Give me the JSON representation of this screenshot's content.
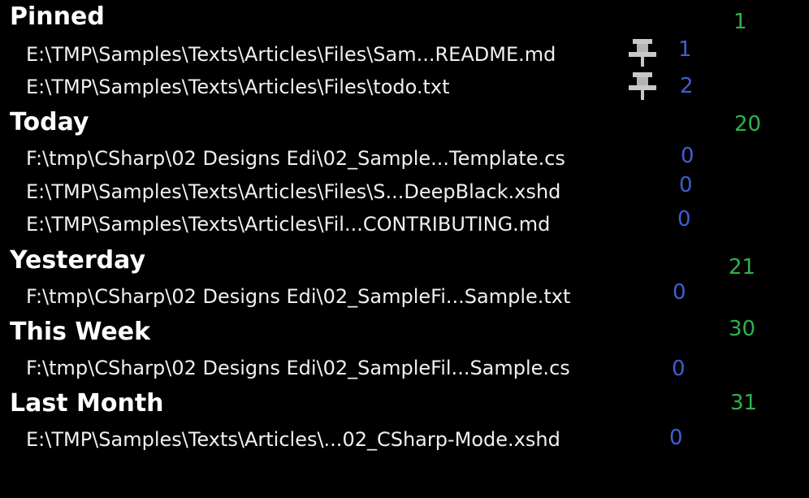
{
  "colors": {
    "background": "#000000",
    "header_text": "#ffffff",
    "path_text": "#f0f0f0",
    "group_count": "#2fb24e",
    "item_count": "#3f5fd0",
    "pin": "#c8c8c8"
  },
  "groups": [
    {
      "title": "Pinned",
      "count": "1",
      "items": [
        {
          "path": "E:\\TMP\\Samples\\Texts\\Articles\\Files\\Sam...README.md",
          "count": "1",
          "icon": "pin-icon"
        },
        {
          "path": "E:\\TMP\\Samples\\Texts\\Articles\\Files\\todo.txt",
          "count": "2",
          "icon": "pin-icon"
        }
      ]
    },
    {
      "title": "Today",
      "count": "20",
      "items": [
        {
          "path": "F:\\tmp\\CSharp\\02 Designs Edi\\02_Sample...Template.cs",
          "count": "0"
        },
        {
          "path": "E:\\TMP\\Samples\\Texts\\Articles\\Files\\S...DeepBlack.xshd",
          "count": "0"
        },
        {
          "path": "E:\\TMP\\Samples\\Texts\\Articles\\Fil...CONTRIBUTING.md",
          "count": "0"
        }
      ]
    },
    {
      "title": "Yesterday",
      "count": "21",
      "items": [
        {
          "path": "F:\\tmp\\CSharp\\02 Designs Edi\\02_SampleFi...Sample.txt",
          "count": "0"
        }
      ]
    },
    {
      "title": "This Week",
      "count": "30",
      "items": [
        {
          "path": "F:\\tmp\\CSharp\\02 Designs Edi\\02_SampleFil...Sample.cs",
          "count": "0"
        }
      ]
    },
    {
      "title": "Last Month",
      "count": "31",
      "items": [
        {
          "path": "E:\\TMP\\Samples\\Texts\\Articles\\...02_CSharp-Mode.xshd",
          "count": "0"
        }
      ]
    }
  ]
}
